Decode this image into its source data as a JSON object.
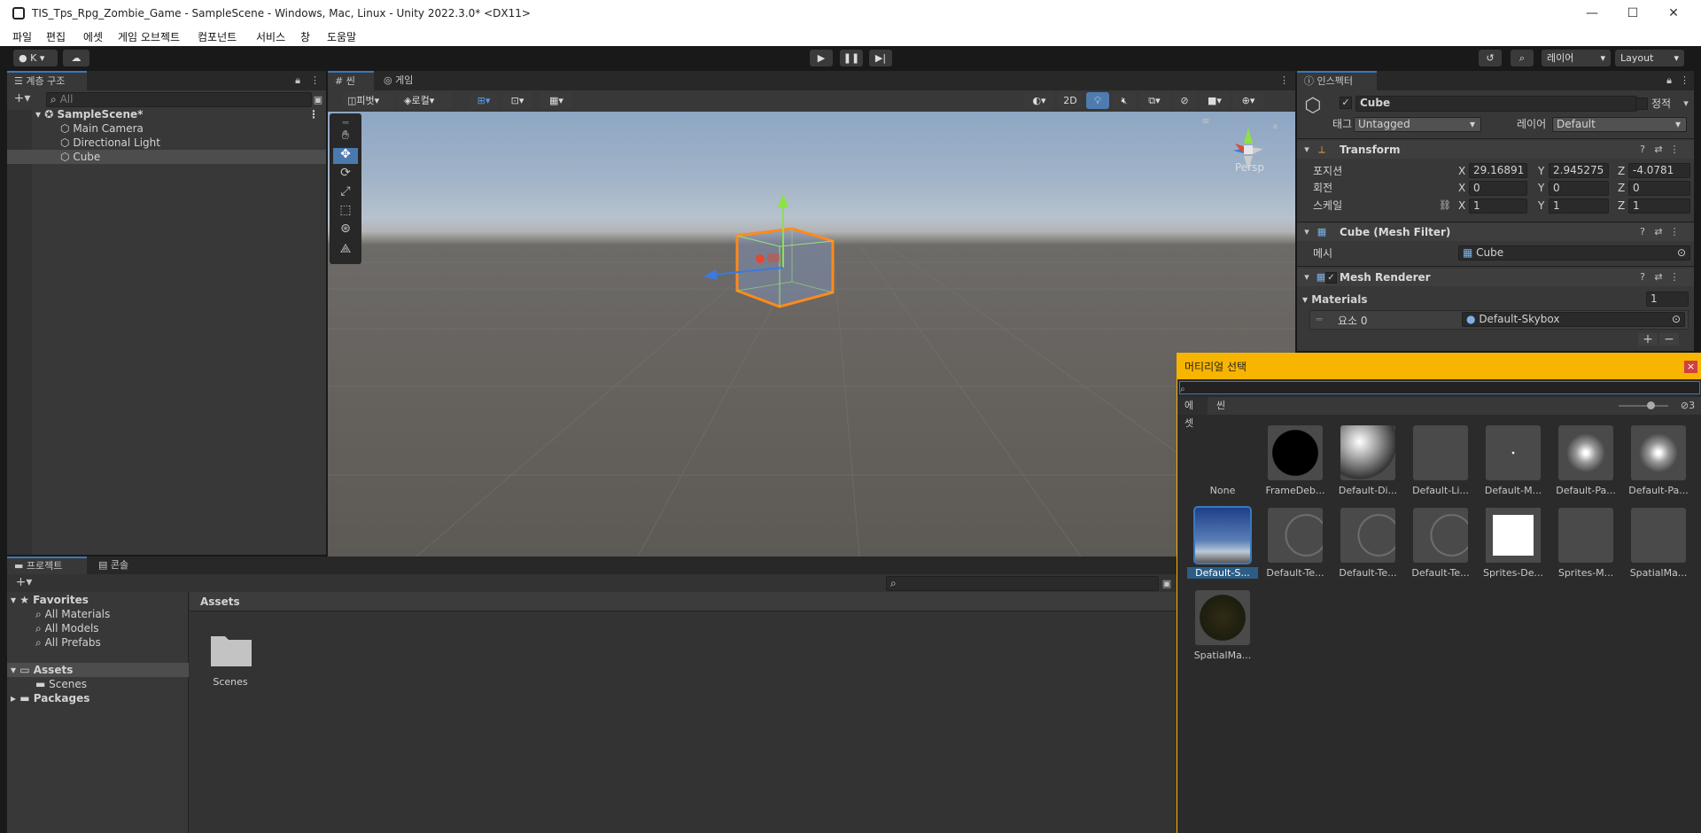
{
  "window": {
    "title": "TIS_Tps_Rpg_Zombie_Game - SampleScene - Windows, Mac, Linux - Unity 2022.3.0* <DX11>",
    "min": "—",
    "max": "☐",
    "close": "✕"
  },
  "menu": [
    "파일",
    "편집",
    "에셋",
    "게임 오브젝트",
    "컴포넌트",
    "서비스",
    "창",
    "도움말"
  ],
  "toolbar": {
    "account": "K",
    "layers": "레이어",
    "layout": "Layout"
  },
  "hierarchy": {
    "tab": "계층 구조",
    "search_placeholder": "All",
    "scene": "SampleScene*",
    "items": [
      "Main Camera",
      "Directional Light",
      "Cube"
    ]
  },
  "scene_view": {
    "tabs": [
      "씬",
      "게임"
    ],
    "pivot": "피벗",
    "local": "로컬",
    "mode2d": "2D",
    "persp": "Persp"
  },
  "inspector": {
    "tab": "인스펙터",
    "object_name": "Cube",
    "static_label": "정적",
    "tag_label": "태그",
    "tag_value": "Untagged",
    "layer_label": "레이어",
    "layer_value": "Default",
    "transform": {
      "title": "Transform",
      "position_label": "포지션",
      "rotation_label": "회전",
      "scale_label": "스케일",
      "position": {
        "x": "29.16891",
        "y": "2.945275",
        "z": "-4.0781"
      },
      "rotation": {
        "x": "0",
        "y": "0",
        "z": "0"
      },
      "scale": {
        "x": "1",
        "y": "1",
        "z": "1"
      }
    },
    "mesh_filter": {
      "title": "Cube (Mesh Filter)",
      "mesh_label": "메시",
      "mesh_value": "Cube"
    },
    "mesh_renderer": {
      "title": "Mesh Renderer",
      "materials_label": "Materials",
      "materials_count": "1",
      "element_label": "요소 0",
      "element_value": "Default-Skybox",
      "add": "+",
      "remove": "−"
    }
  },
  "project": {
    "tabs": [
      "프로젝트",
      "콘솔"
    ],
    "favorites": "Favorites",
    "fav_items": [
      "All Materials",
      "All Models",
      "All Prefabs"
    ],
    "assets": "Assets",
    "assets_children": [
      "Scenes"
    ],
    "packages": "Packages",
    "breadcrumb": "Assets",
    "folder": "Scenes"
  },
  "material_picker": {
    "title": "머티리얼 선택",
    "close": "×",
    "tabs": [
      "에셋",
      "씬"
    ],
    "hidden_count": "3",
    "items": [
      "None",
      "FrameDeb...",
      "Default-Di...",
      "Default-Li...",
      "Default-M...",
      "Default-Pa...",
      "Default-Pa...",
      "Default-S...",
      "Default-Te...",
      "Default-Te...",
      "Default-Te...",
      "Sprites-De...",
      "Sprites-M...",
      "SpatialMa...",
      "SpatialMa..."
    ],
    "selected": "Default-S..."
  },
  "colors": {
    "accent": "#3a79bb",
    "picker_header": "#f8b500",
    "selection": "#2c5d87"
  }
}
